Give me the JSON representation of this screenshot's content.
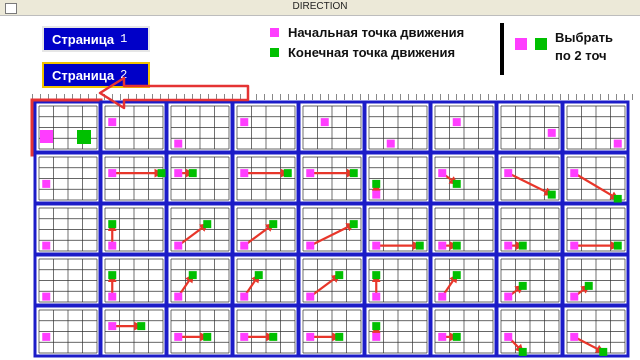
{
  "window": {
    "title": "DIRECTION"
  },
  "buttons": [
    {
      "label": "Страница",
      "num": "1"
    },
    {
      "label": "Страница",
      "num": "2"
    }
  ],
  "legend": [
    {
      "text": "Начальная точка движения",
      "color": "#ff3dff"
    },
    {
      "text": "Конечная точка движения",
      "color": "#00c000"
    }
  ],
  "select_panel": {
    "line1": "Выбрать",
    "line2": "по 2 точ"
  },
  "colors": {
    "start": "#ff3dff",
    "end": "#00c000",
    "cell_border": "#1c1cc8",
    "arrow": "#e8362a",
    "highlight": "#e53333"
  },
  "cards": [
    [
      {
        "s": "c5",
        "e": "c5"
      },
      {
        "s": "a2",
        "e": null
      },
      {
        "s": "a4",
        "e": null
      },
      {
        "s": "a2",
        "e": null
      },
      {
        "s": "b2",
        "e": null
      },
      {
        "s": "b4",
        "e": null
      },
      {
        "s": "b2",
        "e": null
      },
      {
        "s": "d3",
        "e": null
      },
      {
        "s": "d4",
        "e": null
      }
    ],
    [
      {
        "s": "a3",
        "e": null
      },
      {
        "s": "a2",
        "e": "e2"
      },
      {
        "s": "a2",
        "e": "b2"
      },
      {
        "s": "a2",
        "e": "d2"
      },
      {
        "s": "a2",
        "e": "d2"
      },
      {
        "s": "a4",
        "e": "a3"
      },
      {
        "s": "a2",
        "e": "b3"
      },
      {
        "s": "a2",
        "e": "d4"
      },
      {
        "s": "a2",
        "e": "d5"
      }
    ],
    [
      {
        "s": "a4",
        "e": null
      },
      {
        "s": "a4",
        "e": "a2"
      },
      {
        "s": "a4",
        "e": "c2"
      },
      {
        "s": "a4",
        "e": "c2"
      },
      {
        "s": "a4",
        "e": "d2"
      },
      {
        "s": "a4",
        "e": "d4"
      },
      {
        "s": "a4",
        "e": "b4"
      },
      {
        "s": "a4",
        "e": "b4"
      },
      {
        "s": "a4",
        "e": "d4"
      }
    ],
    [
      {
        "s": "a4",
        "e": null
      },
      {
        "s": "a4",
        "e": "a2"
      },
      {
        "s": "a4",
        "e": "b2"
      },
      {
        "s": "a4",
        "e": "b2"
      },
      {
        "s": "a4",
        "e": "c2"
      },
      {
        "s": "a4",
        "e": "a2"
      },
      {
        "s": "a4",
        "e": "b2"
      },
      {
        "s": "a4",
        "e": "b3"
      },
      {
        "s": "a4",
        "e": "b3"
      }
    ],
    [
      {
        "s": "a3",
        "e": null
      },
      {
        "s": "a2",
        "e": "c2"
      },
      {
        "s": "a3",
        "e": "c3"
      },
      {
        "s": "a3",
        "e": "c3"
      },
      {
        "s": "a3",
        "e": "c3"
      },
      {
        "s": "a3",
        "e": "a2"
      },
      {
        "s": "a3",
        "e": "b3"
      },
      {
        "s": "a3",
        "e": "b5"
      },
      {
        "s": "a3",
        "e": "c5"
      }
    ]
  ]
}
